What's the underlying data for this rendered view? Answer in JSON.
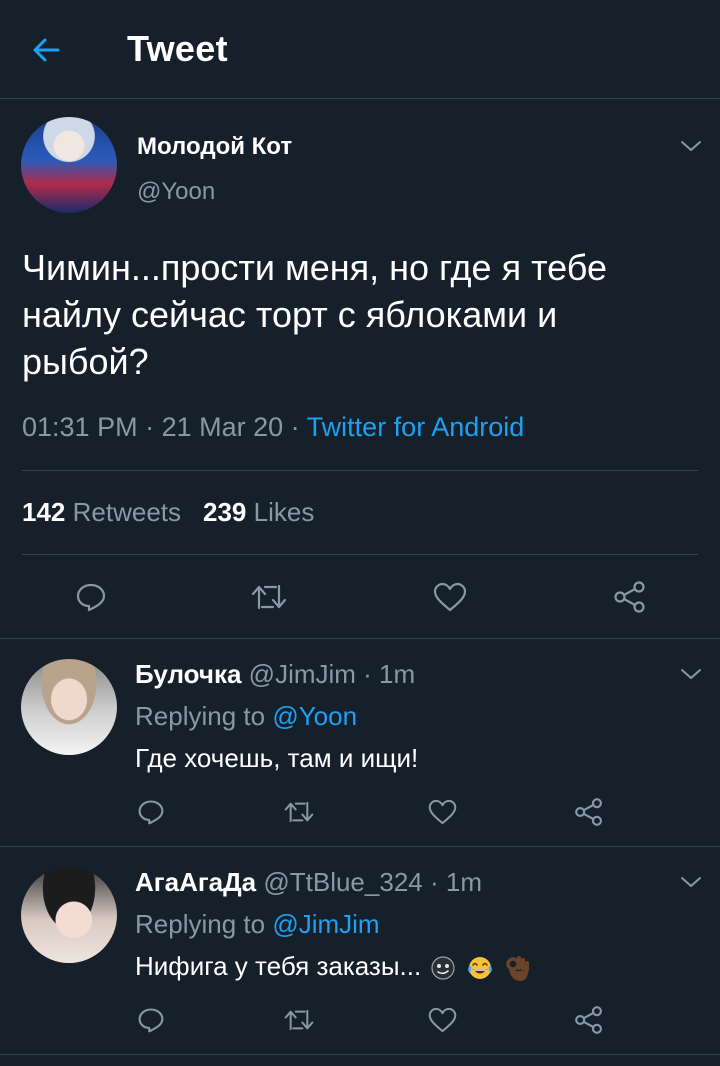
{
  "header": {
    "title": "Tweet"
  },
  "main_tweet": {
    "display_name": "Молодой Кот",
    "handle": "@Yoon",
    "text": "Чимин...прости меня, но где я тебе найлу сейчас торт с яблоками и  рыбой?",
    "time": "01:31 PM",
    "date": "21 Mar 20",
    "separator": " · ",
    "source": "Twitter for Android",
    "retweets_count": "142",
    "retweets_label": "Retweets",
    "likes_count": "239",
    "likes_label": "Likes"
  },
  "replies": [
    {
      "display_name": "Булочка",
      "handle": "@JimJim",
      "dot": " · ",
      "time": "1m",
      "replying_label": "Replying to ",
      "replying_to": "@Yoon",
      "text": "Где хочешь, там и ищи!"
    },
    {
      "display_name": "АгаАгаДа",
      "handle": "@TtBlue_324",
      "dot": " · ",
      "time": "1m",
      "replying_label": "Replying to ",
      "replying_to": "@JimJim",
      "text": "Нифига у тебя заказы...",
      "emojis": [
        "smirk-face-emoji",
        "tears-of-joy-emoji",
        "ok-hand-emoji"
      ]
    }
  ],
  "colors": {
    "background": "#15202b",
    "accent": "#1da1f2",
    "muted": "#8899a6",
    "divider": "#38444d"
  }
}
